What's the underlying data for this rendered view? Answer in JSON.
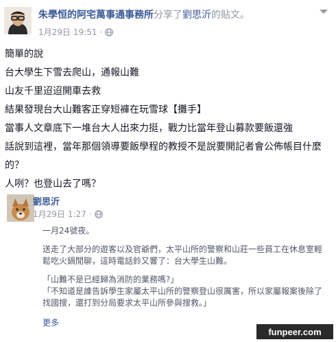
{
  "post": {
    "author": "朱學恒的阿宅萬事通事務所",
    "action_text": "分享了",
    "shared_from": "劉思沂",
    "suffix": "的貼文。",
    "date": "1月29日",
    "time": "19:51",
    "separator": "·",
    "body_lines": [
      "簡單的說",
      "台大學生下雪去爬山，通報山難",
      "山友千里迢迢開車去救",
      "結果發現台大山難客正穿短褲在玩雪球【攤手】",
      "當事人文章底下一堆台大人出來力挺，戰力比當年登山募款要飯還強",
      "話說到這裡，當年那個領導要飯學程的教授不是說要開記者會公佈帳目什麼的？",
      "人咧？也登山去了嗎？"
    ]
  },
  "shared_post": {
    "author": "劉思沂",
    "date": "1月29日",
    "time": "1:27",
    "separator": "·",
    "paragraph1": "一月24號夜。",
    "paragraph2": "送走了大部分的遊客以及官爺們，太平山所的警察和山莊一些員工在休息室輕鬆吃火鍋閒聊，這時電話鈴又響了：台大學生山難。",
    "quote1": "「山難不是已經歸為消防的業務嗎?」",
    "quote2": "「不知道是誰告訴學生家屬太平山所的警察登山很厲害，所以家屬報案後除了找國搜，還打到分局要求太平山所參與搜救。」",
    "more": "更多"
  },
  "watermark": "funpeer.com",
  "icons": {
    "privacy": "globe-icon",
    "menu": "chevron-down-icon"
  },
  "colors": {
    "link": "#3b5998",
    "meta": "#9197a3",
    "text": "#141823"
  }
}
